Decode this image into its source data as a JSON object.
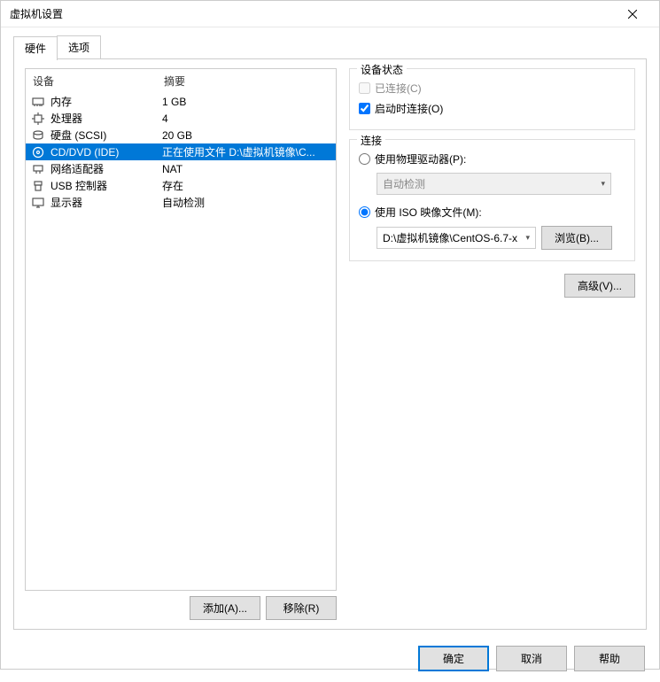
{
  "window": {
    "title": "虚拟机设置"
  },
  "tabs": {
    "hardware": "硬件",
    "options": "选项"
  },
  "listHeader": {
    "device": "设备",
    "summary": "摘要"
  },
  "devices": [
    {
      "icon": "memory-icon",
      "name": "内存",
      "summary": "1 GB",
      "selected": false
    },
    {
      "icon": "cpu-icon",
      "name": "处理器",
      "summary": "4",
      "selected": false
    },
    {
      "icon": "disk-icon",
      "name": "硬盘 (SCSI)",
      "summary": "20 GB",
      "selected": false
    },
    {
      "icon": "cd-icon",
      "name": "CD/DVD (IDE)",
      "summary": "正在使用文件 D:\\虚拟机镜像\\C...",
      "selected": true
    },
    {
      "icon": "network-icon",
      "name": "网络适配器",
      "summary": "NAT",
      "selected": false
    },
    {
      "icon": "usb-icon",
      "name": "USB 控制器",
      "summary": "存在",
      "selected": false
    },
    {
      "icon": "display-icon",
      "name": "显示器",
      "summary": "自动检测",
      "selected": false
    }
  ],
  "buttons": {
    "add": "添加(A)...",
    "remove": "移除(R)",
    "browse": "浏览(B)...",
    "advanced": "高级(V)...",
    "ok": "确定",
    "cancel": "取消",
    "help": "帮助"
  },
  "status": {
    "groupTitle": "设备状态",
    "connected": "已连接(C)",
    "connectAtPowerOn": "启动时连接(O)"
  },
  "connection": {
    "groupTitle": "连接",
    "usePhysical": "使用物理驱动器(P):",
    "autoDetect": "自动检测",
    "useIso": "使用 ISO 映像文件(M):",
    "isoPath": "D:\\虚拟机镜像\\CentOS-6.7-x"
  }
}
